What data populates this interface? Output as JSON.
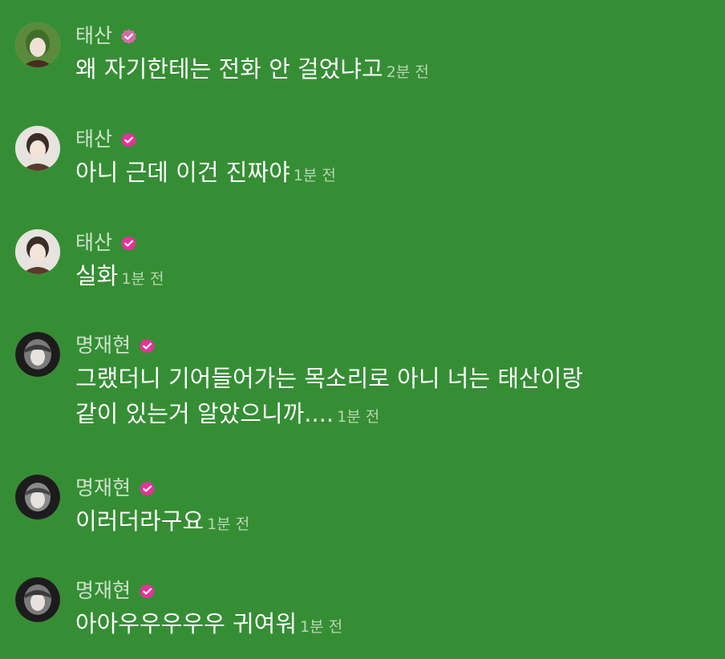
{
  "messages": [
    {
      "author": "태산",
      "text": "왜 자기한테는 전화 안 걸었냐고",
      "time": "2분 전",
      "avatar_icon": "taesan-avatar-icon",
      "avatar_colors": {
        "bg": "#5b8a3c",
        "hair": "#3f6e2a",
        "face": "#efe1d6"
      },
      "verified_color": "#d66aa7"
    },
    {
      "author": "태산",
      "text": "아니 근데 이건 진짜야",
      "time": "1분 전",
      "avatar_icon": "taesan-avatar-icon",
      "avatar_colors": {
        "bg": "#e7e3de",
        "hair": "#3a2d26",
        "face": "#f3e4da"
      },
      "verified_color": "#e9309b"
    },
    {
      "author": "태산",
      "text": "실화",
      "time": "1분 전",
      "avatar_icon": "taesan-avatar-icon",
      "avatar_colors": {
        "bg": "#e7e3de",
        "hair": "#3a2d26",
        "face": "#f3e4da"
      },
      "verified_color": "#e9309b"
    },
    {
      "author": "명재현",
      "text": "그랬더니 기어들어가는 목소리로 아니 너는 태산이랑\n같이 있는거 알았으니까....",
      "time": "1분 전",
      "avatar_icon": "myungjaehyun-avatar-icon",
      "avatar_colors": {
        "bg": "#1c1c1c",
        "hair": "#7b7b7b",
        "face": "#e8e2dd"
      },
      "verified_color": "#e9309b"
    },
    {
      "author": "명재현",
      "text": "이러더라구요",
      "time": "1분 전",
      "avatar_icon": "myungjaehyun-avatar-icon",
      "avatar_colors": {
        "bg": "#1c1c1c",
        "hair": "#7b7b7b",
        "face": "#e8e2dd"
      },
      "verified_color": "#e9309b"
    },
    {
      "author": "명재현",
      "text": "아아우우우우우 귀여워",
      "time": "1분 전",
      "avatar_icon": "myungjaehyun-avatar-icon",
      "avatar_colors": {
        "bg": "#1c1c1c",
        "hair": "#7b7b7b",
        "face": "#e8e2dd"
      },
      "verified_color": "#e9309b"
    }
  ],
  "colors": {
    "background": "#358e34",
    "name_text": "#cfe3cc",
    "message_text": "#ffffff",
    "time_text": "#b9d6b5"
  }
}
